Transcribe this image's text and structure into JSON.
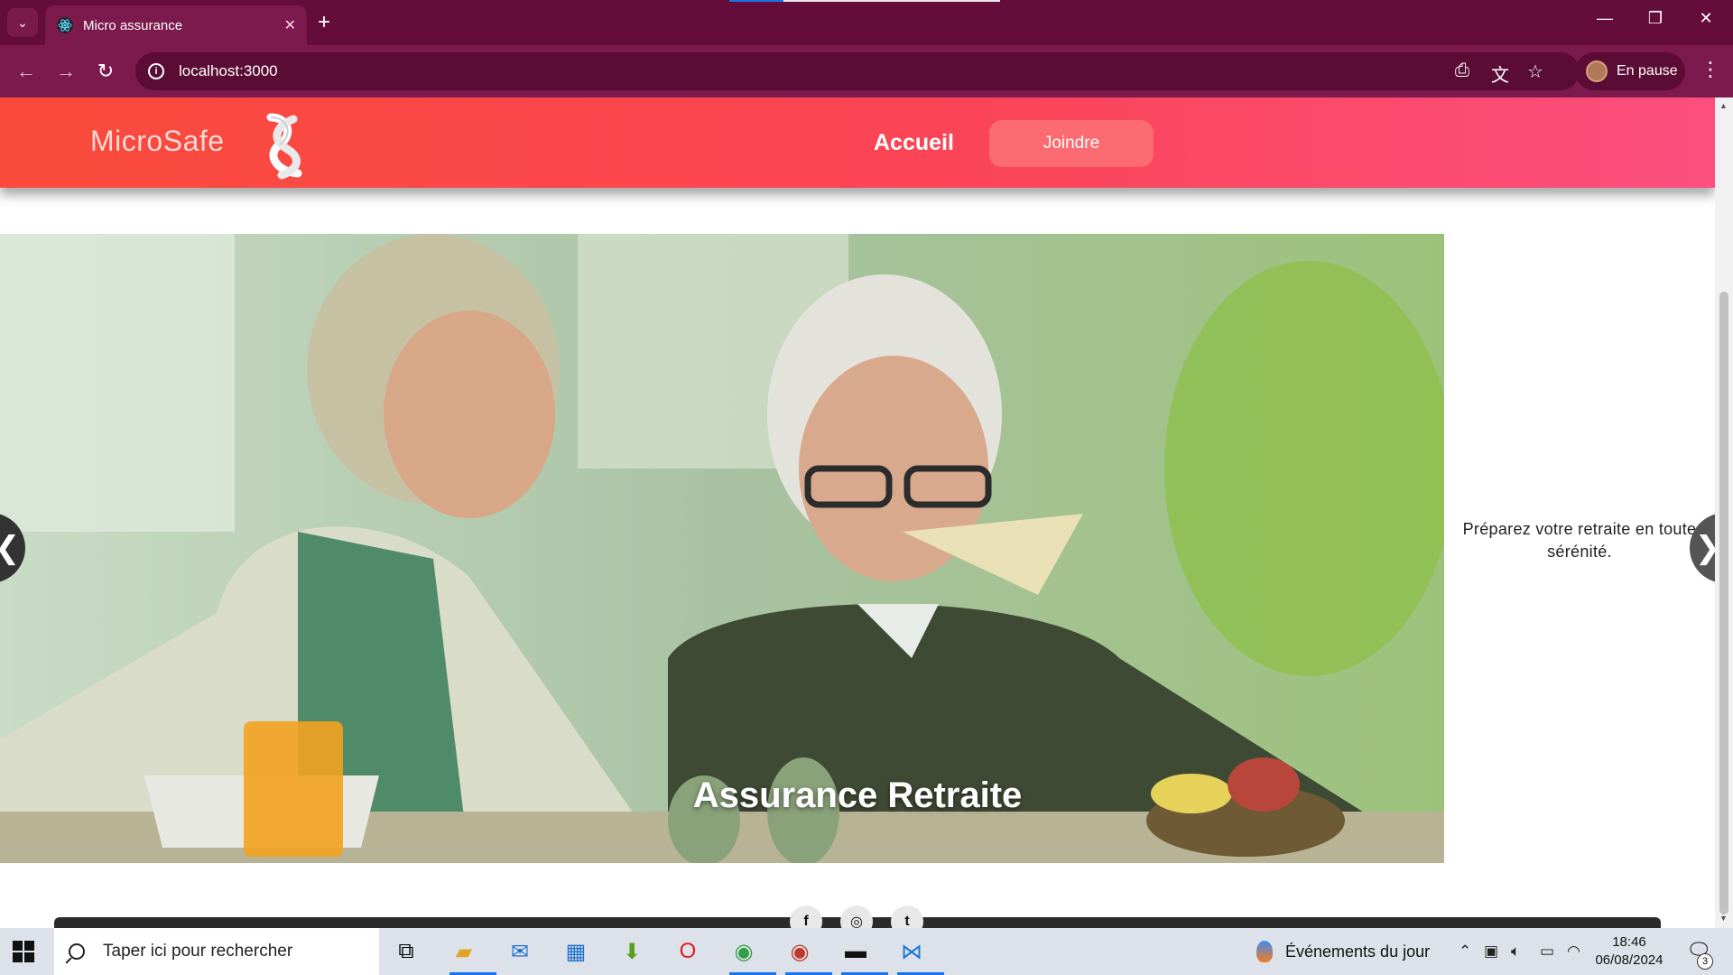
{
  "browser": {
    "tab_title": "Micro assurance",
    "tab_close": "✕",
    "new_tab": "+",
    "url": "localhost:3000",
    "profile_label": "En pause",
    "window_controls": {
      "minimize": "—",
      "restore": "❐",
      "close": "✕"
    },
    "nav": {
      "back": "←",
      "forward": "→",
      "reload": "↻",
      "menu": "⋮"
    },
    "icons": {
      "install": "install-app-icon",
      "translate": "translate-icon",
      "bookmark": "star-icon"
    }
  },
  "site": {
    "brand": "MicroSafe",
    "nav": {
      "home": "Accueil",
      "join": "Joindre"
    },
    "accent_color": "#fb4456"
  },
  "carousel": {
    "caption": "Assurance Retraite",
    "side_text": "Préparez votre retraite en toute sérénité.",
    "prev": "❮",
    "next": "❯"
  },
  "social": [
    "f",
    "◎",
    "t"
  ],
  "taskbar": {
    "search_placeholder": "Taper ici pour rechercher",
    "events": "Événements du jour",
    "time": "18:46",
    "date": "06/08/2024",
    "notification_count": "3"
  }
}
